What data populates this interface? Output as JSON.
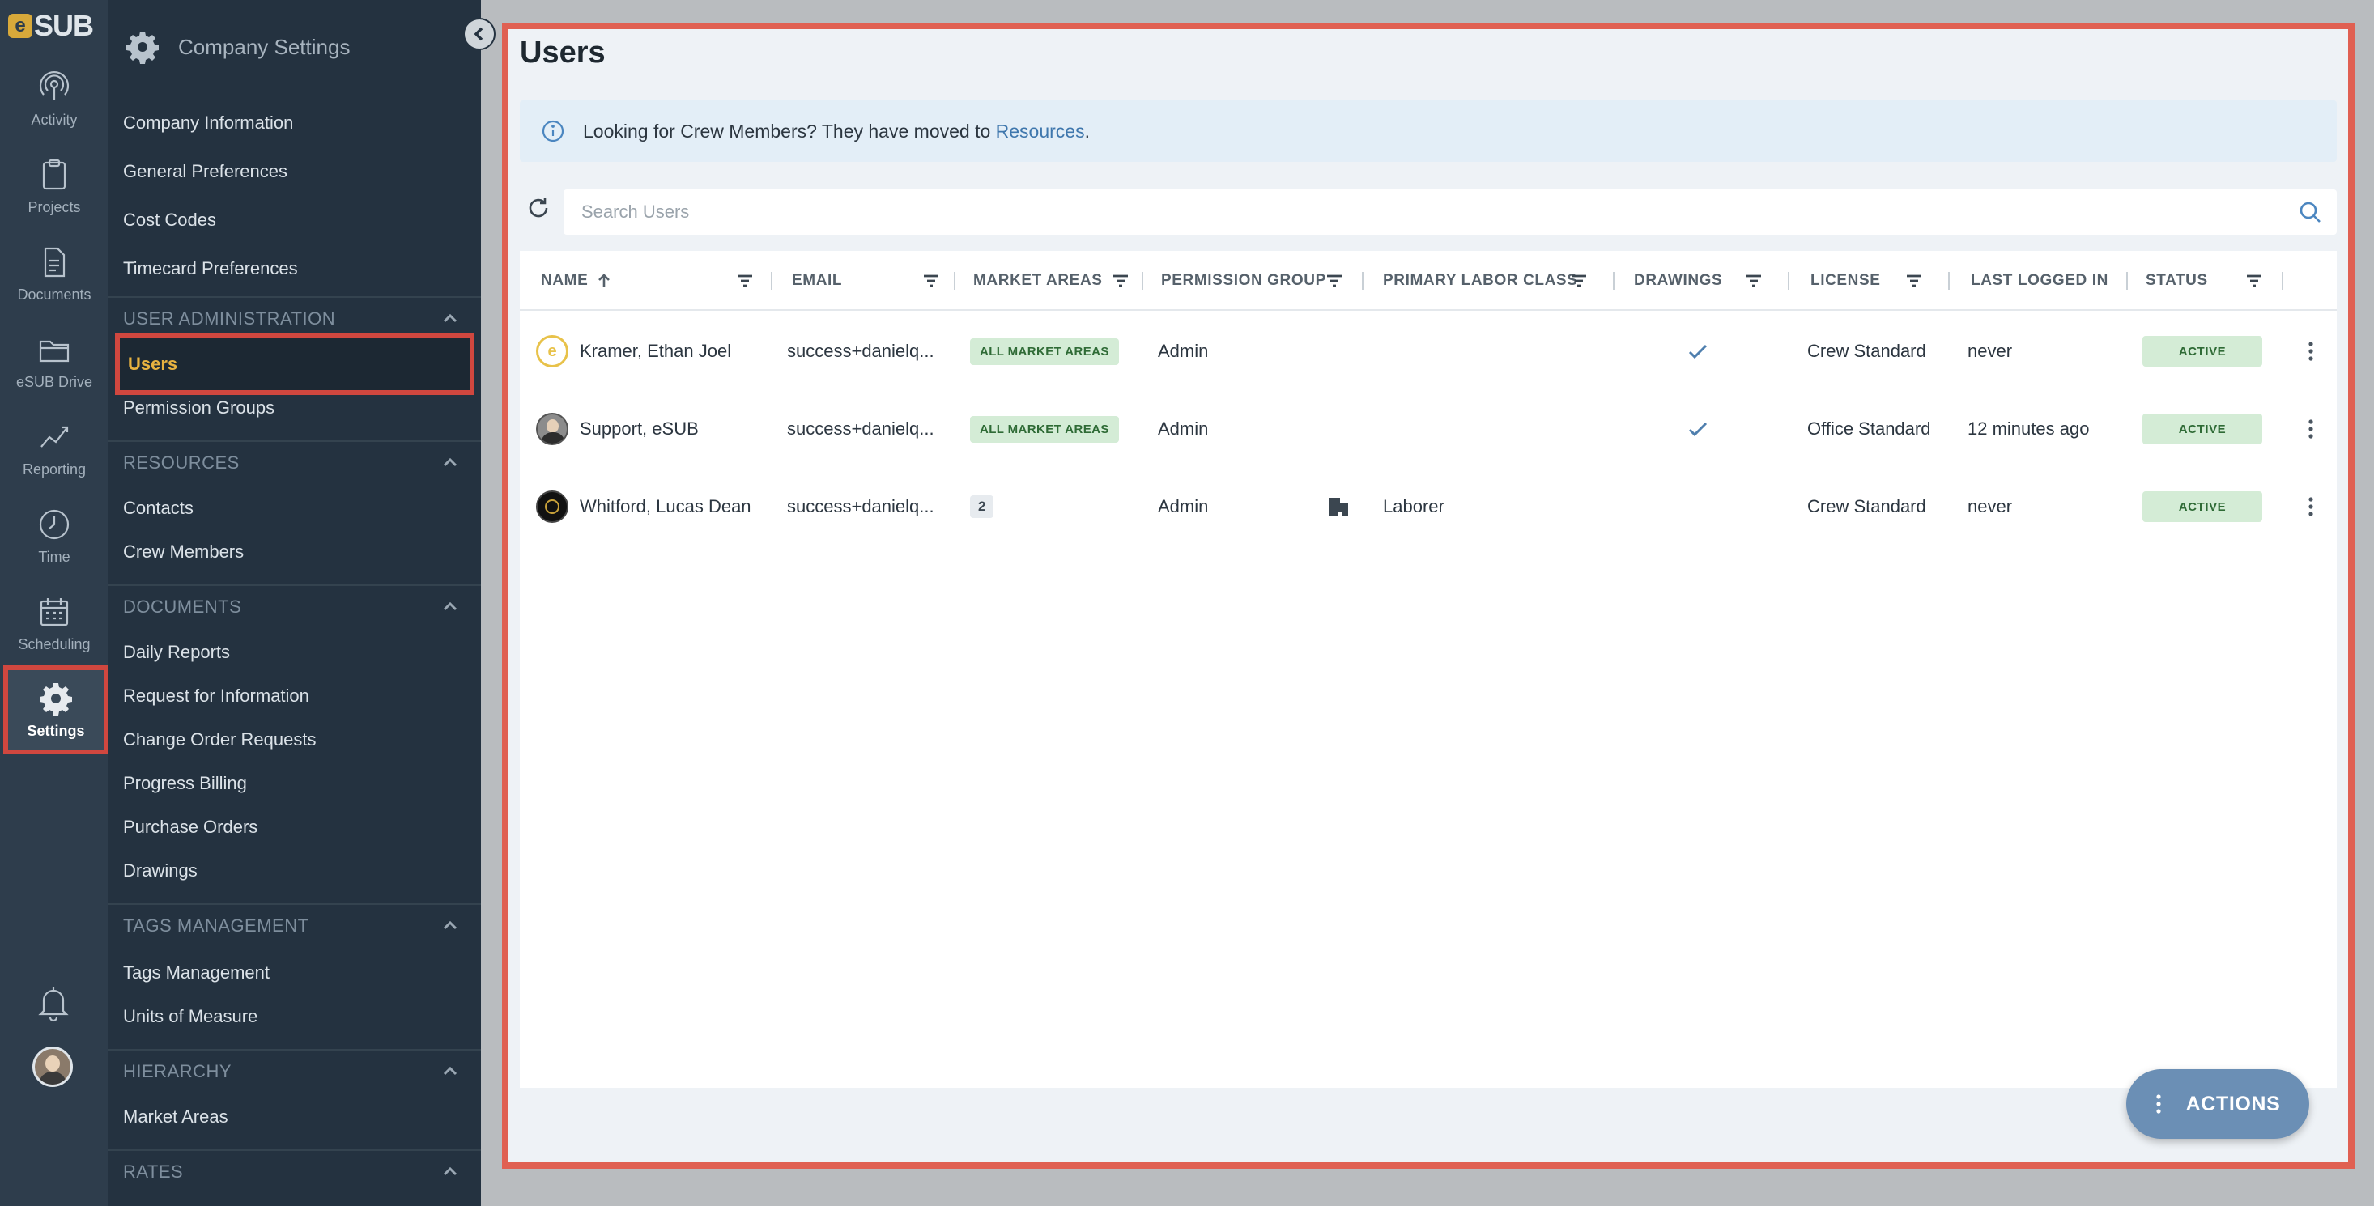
{
  "app": {
    "logo_letter": "e",
    "logo_text": "SUB"
  },
  "rail": {
    "items": [
      {
        "label": "Activity",
        "icon": "activity-icon"
      },
      {
        "label": "Projects",
        "icon": "clipboard-icon"
      },
      {
        "label": "Documents",
        "icon": "document-icon"
      },
      {
        "label": "eSUB Drive",
        "icon": "folder-icon"
      },
      {
        "label": "Reporting",
        "icon": "chart-icon"
      },
      {
        "label": "Time",
        "icon": "clock-icon"
      },
      {
        "label": "Scheduling",
        "icon": "calendar-icon"
      },
      {
        "label": "Settings",
        "icon": "gear-icon"
      }
    ]
  },
  "sidebar": {
    "title": "Company Settings",
    "top_links": [
      "Company Information",
      "General Preferences",
      "Cost Codes",
      "Timecard Preferences"
    ],
    "sections": [
      {
        "title": "USER ADMINISTRATION",
        "items": [
          "Users",
          "Permission Groups"
        ]
      },
      {
        "title": "RESOURCES",
        "items": [
          "Contacts",
          "Crew Members"
        ]
      },
      {
        "title": "DOCUMENTS",
        "items": [
          "Daily Reports",
          "Request for Information",
          "Change Order Requests",
          "Progress Billing",
          "Purchase Orders",
          "Drawings"
        ]
      },
      {
        "title": "TAGS MANAGEMENT",
        "items": [
          "Tags Management",
          "Units of Measure"
        ]
      },
      {
        "title": "HIERARCHY",
        "items": [
          "Market Areas"
        ]
      },
      {
        "title": "RATES",
        "items": []
      }
    ],
    "active_item": "Users"
  },
  "main": {
    "title": "Users",
    "notice": {
      "text": "Looking for Crew Members? They have moved to ",
      "link": "Resources",
      "end": "."
    },
    "search": {
      "placeholder": "Search Users"
    },
    "columns": [
      "NAME",
      "EMAIL",
      "MARKET AREAS",
      "PERMISSION GROUP",
      "PRIMARY LABOR CLASS",
      "DRAWINGS",
      "LICENSE",
      "LAST LOGGED IN",
      "STATUS"
    ],
    "rows": [
      {
        "name": "Kramer, Ethan Joel",
        "email": "success+danielq...",
        "market_areas": "ALL MARKET AREAS",
        "permission_group": "Admin",
        "labor_class": "",
        "drawings": true,
        "license": "Crew Standard",
        "last_logged_in": "never",
        "status": "ACTIVE"
      },
      {
        "name": "Support, eSUB",
        "email": "success+danielq...",
        "market_areas": "ALL MARKET AREAS",
        "permission_group": "Admin",
        "labor_class": "",
        "drawings": true,
        "license": "Office Standard",
        "last_logged_in": "12 minutes ago",
        "status": "ACTIVE"
      },
      {
        "name": "Whitford, Lucas Dean",
        "email": "success+danielq...",
        "market_areas": "2",
        "permission_group": "Admin",
        "labor_class": "Laborer",
        "drawings": false,
        "license": "Crew Standard",
        "last_logged_in": "never",
        "status": "ACTIVE"
      }
    ],
    "actions_label": "ACTIONS"
  },
  "colors": {
    "rail_bg": "#2e3d4c",
    "sidebar_bg": "#243240",
    "active_gold": "#e7b240",
    "highlight_red": "#d0473f",
    "status_green_bg": "#d4ecd6",
    "accent_blue": "#4b86c0"
  }
}
